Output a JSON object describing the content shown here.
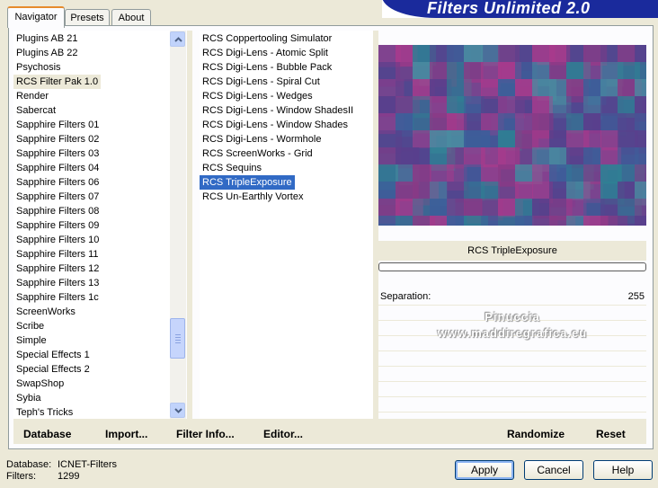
{
  "tabs": [
    "Navigator",
    "Presets",
    "About"
  ],
  "banner_title": "Filters Unlimited 2.0",
  "categories": [
    "Plugins AB 21",
    "Plugins AB 22",
    "Psychosis",
    "RCS Filter Pak 1.0",
    "Render",
    "Sabercat",
    "Sapphire Filters 01",
    "Sapphire Filters 02",
    "Sapphire Filters 03",
    "Sapphire Filters 04",
    "Sapphire Filters 06",
    "Sapphire Filters 07",
    "Sapphire Filters 08",
    "Sapphire Filters 09",
    "Sapphire Filters 10",
    "Sapphire Filters 11",
    "Sapphire Filters 12",
    "Sapphire Filters 13",
    "Sapphire Filters 1c",
    "ScreenWorks",
    "Scribe",
    "Simple",
    "Special Effects 1",
    "Special Effects 2",
    "SwapShop",
    "Sybia",
    "Teph's Tricks"
  ],
  "selected_category": "RCS Filter Pak 1.0",
  "filters": [
    "RCS Coppertooling Simulator",
    "RCS Digi-Lens - Atomic Split",
    "RCS Digi-Lens - Bubble Pack",
    "RCS Digi-Lens - Spiral Cut",
    "RCS Digi-Lens - Wedges",
    "RCS Digi-Lens - Window ShadesII",
    "RCS Digi-Lens - Window Shades",
    "RCS Digi-Lens - Wormhole",
    "RCS ScreenWorks - Grid",
    "RCS Sequins",
    "RCS TripleExposure",
    "RCS Un-Earthly Vortex"
  ],
  "selected_filter": "RCS TripleExposure",
  "filter_name_display": "RCS TripleExposure",
  "parameter": {
    "label": "Separation:",
    "value": "255"
  },
  "watermark": {
    "line1": "Pinuccia",
    "line2": "www.maddiregrafica.eu"
  },
  "bottom_buttons": {
    "database": "Database",
    "import": "Import...",
    "filter_info": "Filter Info...",
    "editor": "Editor...",
    "randomize": "Randomize",
    "reset": "Reset"
  },
  "status": {
    "database_label": "Database:",
    "database_value": "ICNET-Filters",
    "filters_label": "Filters:",
    "filters_value": "1299"
  },
  "dialog_buttons": {
    "apply": "Apply",
    "cancel": "Cancel",
    "help": "Help"
  },
  "colors": {
    "selection": "#316ac5",
    "banner": "#1a2a9c",
    "tab_highlight": "#e68b2c",
    "preview_magenta": "#a83a8c",
    "preview_teal": "#2f7f94",
    "preview_purple": "#5a3f8c"
  }
}
